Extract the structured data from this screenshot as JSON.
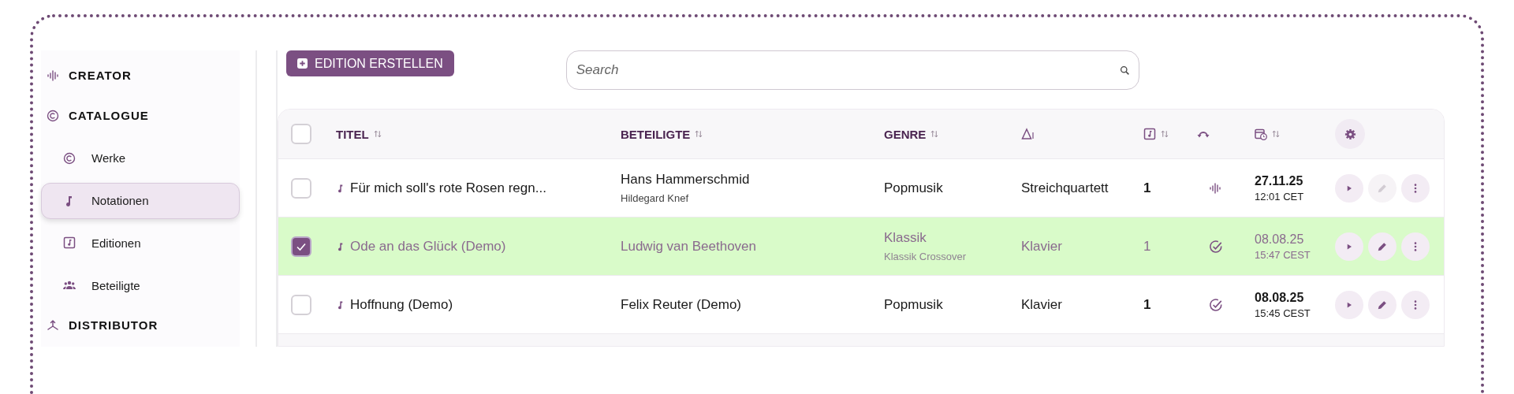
{
  "sidebar": {
    "items": [
      {
        "kind": "section",
        "label": "CREATOR"
      },
      {
        "kind": "section",
        "label": "CATALOGUE"
      },
      {
        "kind": "item",
        "label": "Werke",
        "selected": false
      },
      {
        "kind": "item",
        "label": "Notationen",
        "selected": true
      },
      {
        "kind": "item",
        "label": "Editionen",
        "selected": false
      },
      {
        "kind": "item",
        "label": "Beteiligte",
        "selected": false
      },
      {
        "kind": "section",
        "label": "DISTRIBUTOR"
      }
    ]
  },
  "create_button": {
    "label": "EDITION ERSTELLEN"
  },
  "search": {
    "placeholder": "Search"
  },
  "table": {
    "select_all": {
      "checked": false
    },
    "columns": [
      {
        "label": "TITEL",
        "sortable": true
      },
      {
        "label": "BETEILIGTE",
        "sortable": true
      },
      {
        "label": "GENRE",
        "sortable": true
      },
      {
        "sortable": false
      },
      {
        "sortable": true
      },
      {
        "sortable": false
      },
      {
        "sortable": true
      }
    ],
    "rows": [
      {
        "selected": false,
        "title": "Für mich soll's rote Rosen regn...",
        "participant": "Hans Hammerschmid",
        "participant_sub": "Hildegard Knef",
        "genre": "Popmusik",
        "instrumentation": "Streichquartett",
        "count": "1",
        "kind": "waveform",
        "date": "27.11.25",
        "time": "12:01 CET",
        "edit_disabled": true
      },
      {
        "selected": true,
        "title": "Ode an das Glück (Demo)",
        "participant": "Ludwig van Beethoven",
        "genre": "Klassik",
        "genre_sub": "Klassik Crossover",
        "instrumentation": "Klavier",
        "count": "1",
        "kind": "check",
        "date": "08.08.25",
        "time": "15:47 CEST",
        "edit_disabled": false
      },
      {
        "selected": false,
        "title": "Hoffnung (Demo)",
        "participant": "Felix Reuter (Demo)",
        "genre": "Popmusik",
        "instrumentation": "Klavier",
        "count": "1",
        "kind": "check",
        "date": "08.08.25",
        "time": "15:45 CEST",
        "edit_disabled": false
      }
    ]
  }
}
